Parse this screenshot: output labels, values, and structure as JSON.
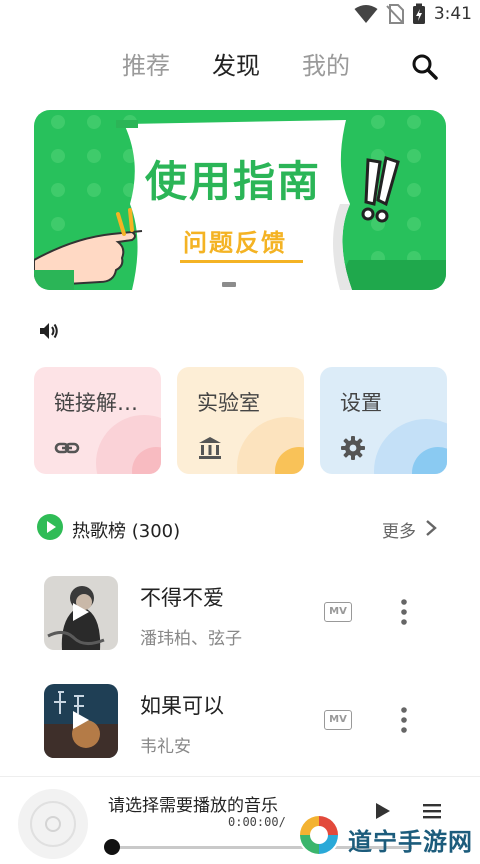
{
  "status_bar": {
    "time": "3:41",
    "icons": [
      "wifi-icon",
      "no-sim-icon",
      "battery-charging-icon"
    ]
  },
  "tabs": [
    {
      "label": "推荐",
      "active": false
    },
    {
      "label": "发现",
      "active": true
    },
    {
      "label": "我的",
      "active": false
    }
  ],
  "banner": {
    "title": "使用指南",
    "subtitle": "问题反馈",
    "colors": {
      "background": "#28c15c",
      "title": "#2bb557",
      "subtitle": "#f4b324"
    }
  },
  "cards": [
    {
      "label": "链接解…",
      "icon": "link-icon",
      "color": "#fde3e6"
    },
    {
      "label": "实验室",
      "icon": "bank-icon",
      "color": "#fdeed6"
    },
    {
      "label": "设置",
      "icon": "gear-icon",
      "color": "#dcecf8"
    }
  ],
  "hot_list": {
    "title": "热歌榜 (300)",
    "more_label": "更多"
  },
  "songs": [
    {
      "title": "不得不爱",
      "artist": "潘玮柏、弦子",
      "badge": "MV"
    },
    {
      "title": "如果可以",
      "artist": "韦礼安",
      "badge": "MV"
    }
  ],
  "player": {
    "prompt": "请选择需要播放的音乐",
    "time": "0:00:00/",
    "progress": 0
  },
  "watermark": {
    "text": "道宁手游网"
  }
}
